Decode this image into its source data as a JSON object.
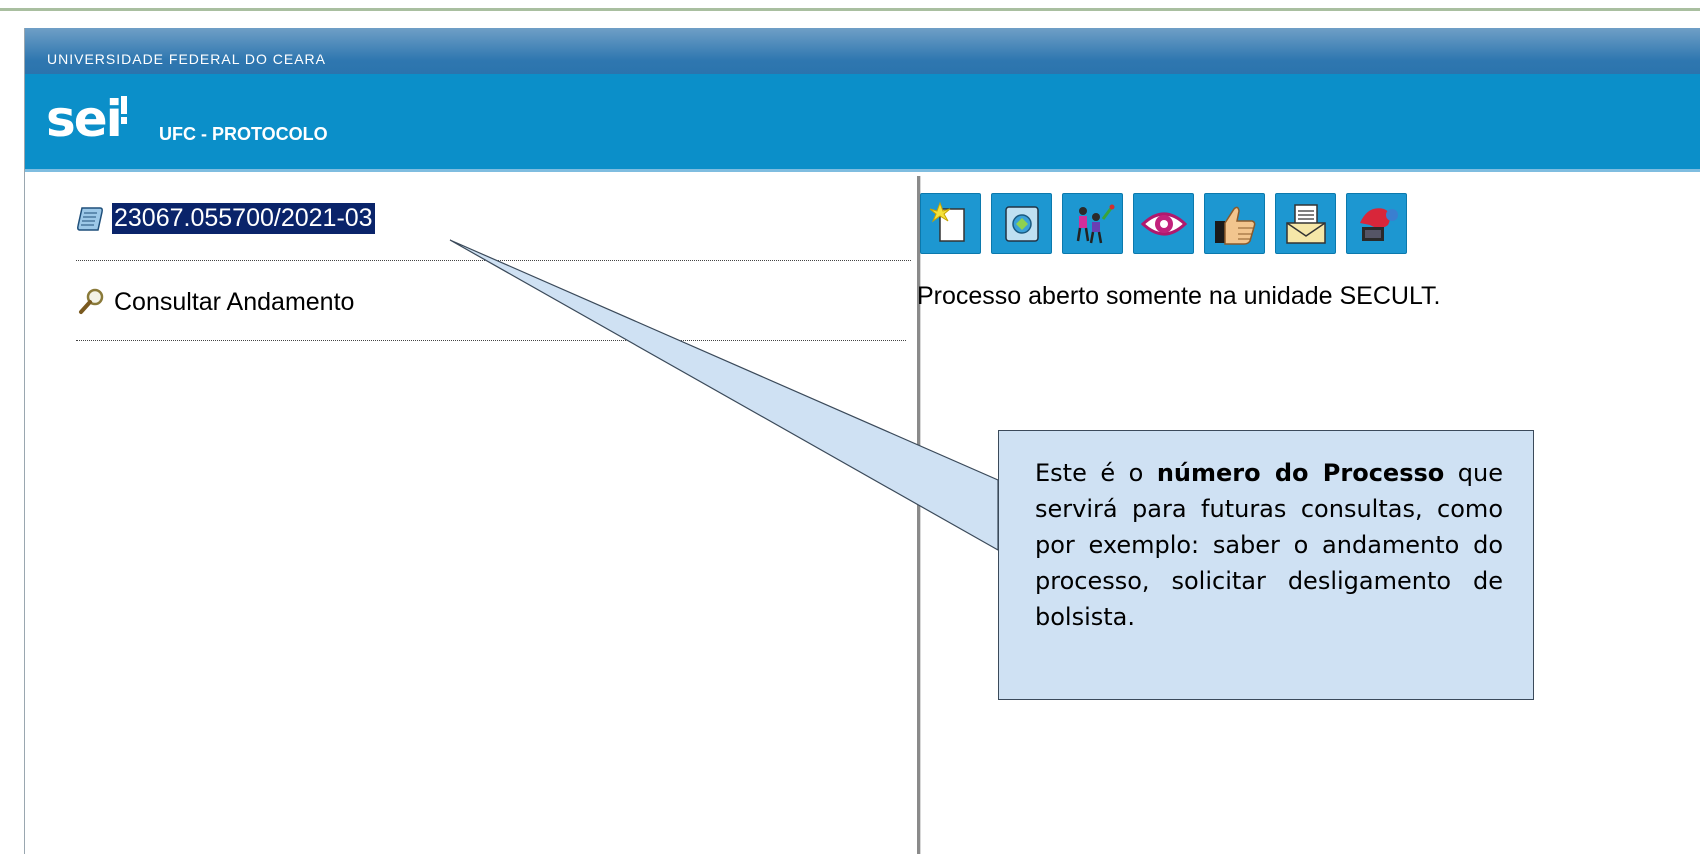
{
  "header": {
    "institution": "UNIVERSIDADE FEDERAL DO CEARA",
    "logo_text": "sei",
    "unit": "UFC - PROTOCOLO"
  },
  "tree": {
    "process_number": "23067.055700/2021-03",
    "consult_label": "Consultar Andamento"
  },
  "toolbar": {
    "buttons": [
      {
        "icon": "new-document-icon"
      },
      {
        "icon": "start-process-icon"
      },
      {
        "icon": "people-icon"
      },
      {
        "icon": "eye-icon"
      },
      {
        "icon": "thumbs-up-icon"
      },
      {
        "icon": "email-document-icon"
      },
      {
        "icon": "send-icon"
      }
    ]
  },
  "main": {
    "status_text": "Processo aberto somente na unidade SECULT."
  },
  "callout": {
    "prefix": "Este é o ",
    "bold": "número do Processo",
    "suffix": " que servirá para futuras consultas, como por exemplo: saber o andamento do processo, solicitar desligamento de bolsista."
  },
  "colors": {
    "header_top": "#2f77b0",
    "header_main": "#0b8fc9",
    "selection": "#0a246a",
    "callout_bg": "#cfe1f3"
  }
}
